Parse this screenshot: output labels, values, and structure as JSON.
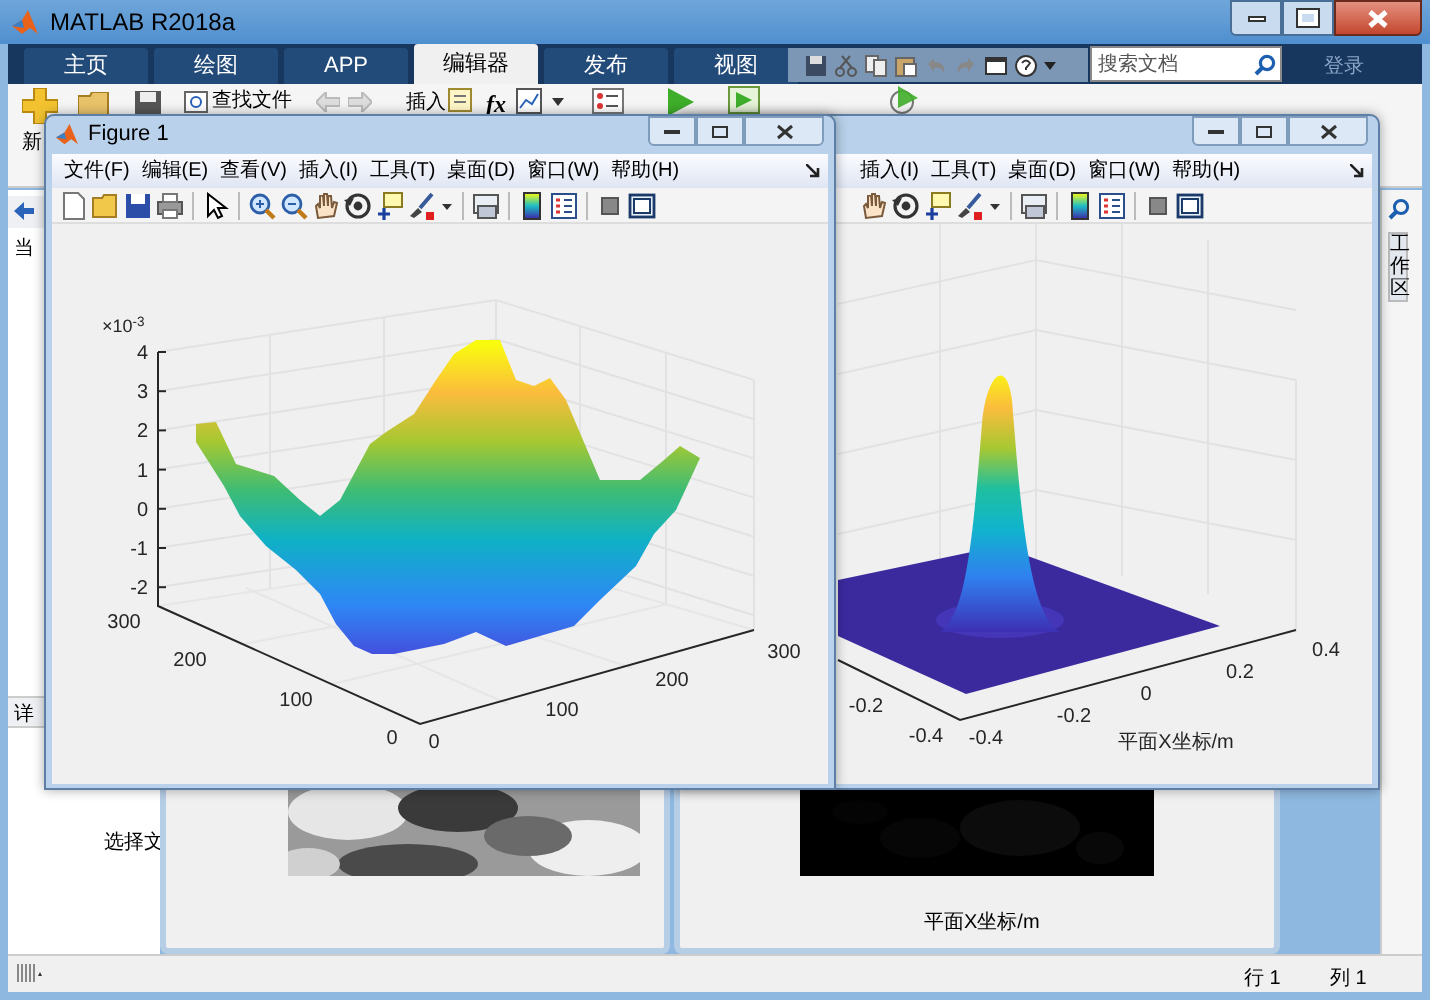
{
  "window": {
    "title": "MATLAB R2018a"
  },
  "ribbon_tabs": [
    {
      "label": "主页",
      "selected": false
    },
    {
      "label": "绘图",
      "selected": false
    },
    {
      "label": "APP",
      "selected": false
    },
    {
      "label": "编辑器",
      "selected": true
    },
    {
      "label": "发布",
      "selected": false
    },
    {
      "label": "视图",
      "selected": false
    }
  ],
  "search": {
    "placeholder": "搜索文档"
  },
  "login": "登录",
  "toolbar": {
    "new_label": "新",
    "find_files": "查找文件",
    "insert": "插入",
    "function_glyph": "fx"
  },
  "left_panel": {
    "header": "当",
    "details": "详",
    "hint": "选择文"
  },
  "right_panel": {
    "tab": "工作区"
  },
  "lower_figures": [
    {
      "kind": "picture"
    },
    {
      "kind": "picture",
      "xlabel": "平面X坐标/m"
    }
  ],
  "figures": [
    {
      "title": "Figure 1",
      "menu": [
        "文件(F)",
        "编辑(E)",
        "查看(V)",
        "插入(I)",
        "工具(T)",
        "桌面(D)",
        "窗口(W)",
        "帮助(H)"
      ],
      "plot": {
        "kind": "terrain",
        "exponent": "×10$^{-3}$",
        "z_ticks": [
          "4",
          "3",
          "2",
          "1",
          "0",
          "-1",
          "-2"
        ],
        "y_ticks": [
          "300",
          "200",
          "100",
          "0"
        ],
        "x_ticks": [
          "0",
          "100",
          "200",
          "300"
        ]
      }
    },
    {
      "menu": [
        "插入(I)",
        "工具(T)",
        "桌面(D)",
        "窗口(W)",
        "帮助(H)"
      ],
      "plot": {
        "kind": "peak",
        "x_ticks": [
          "-0.4",
          "-0.2",
          "0",
          "0.2",
          "0.4"
        ],
        "y_ticks": [
          "-0.2",
          "-0.4"
        ],
        "xlabel": "平面X坐标/m"
      }
    }
  ],
  "status_bar": {
    "row": "行 1",
    "col": "列 1"
  }
}
